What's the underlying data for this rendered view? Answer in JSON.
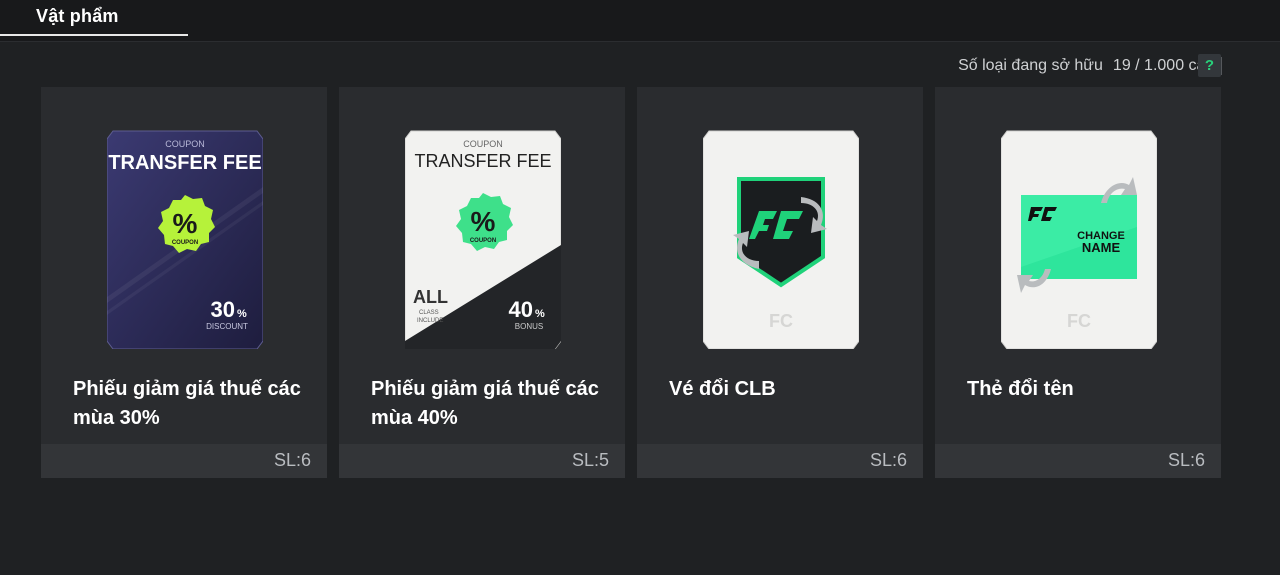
{
  "header": {
    "tab_label": "Vật phẩm"
  },
  "inventory": {
    "owned_label": "Số loại đang sở hữu",
    "owned_count": "19 / 1.000 cái",
    "help_label": "?"
  },
  "items": [
    {
      "name": "Phiếu giảm giá thuế các mùa 30%",
      "qty": "SL:6",
      "card": {
        "coupon": "COUPON",
        "title": "TRANSFER FEE",
        "badge_icon": "%",
        "badge_text": "COUPON",
        "value": "30",
        "unit": "%",
        "sub": "DISCOUNT"
      }
    },
    {
      "name": "Phiếu giảm giá thuế các mùa 40%",
      "qty": "SL:5",
      "card": {
        "coupon": "COUPON",
        "title": "TRANSFER FEE",
        "badge_icon": "%",
        "badge_text": "COUPON",
        "value": "40",
        "unit": "%",
        "sub": "BONUS",
        "left_big": "ALL",
        "left_sub1": "CLASS",
        "left_sub2": "INCLUDE"
      }
    },
    {
      "name": "Vé đổi CLB",
      "qty": "SL:6",
      "card": {
        "icon": "club-change-shield-icon"
      }
    },
    {
      "name": "Thẻ đổi tên",
      "qty": "SL:6",
      "card": {
        "icon": "name-change-card-icon",
        "line1": "CHANGE",
        "line2": "NAME"
      }
    }
  ],
  "colors": {
    "accent": "#28d07a",
    "coupon_green": "#b6f23a",
    "coupon_teal": "#3ee08a"
  }
}
